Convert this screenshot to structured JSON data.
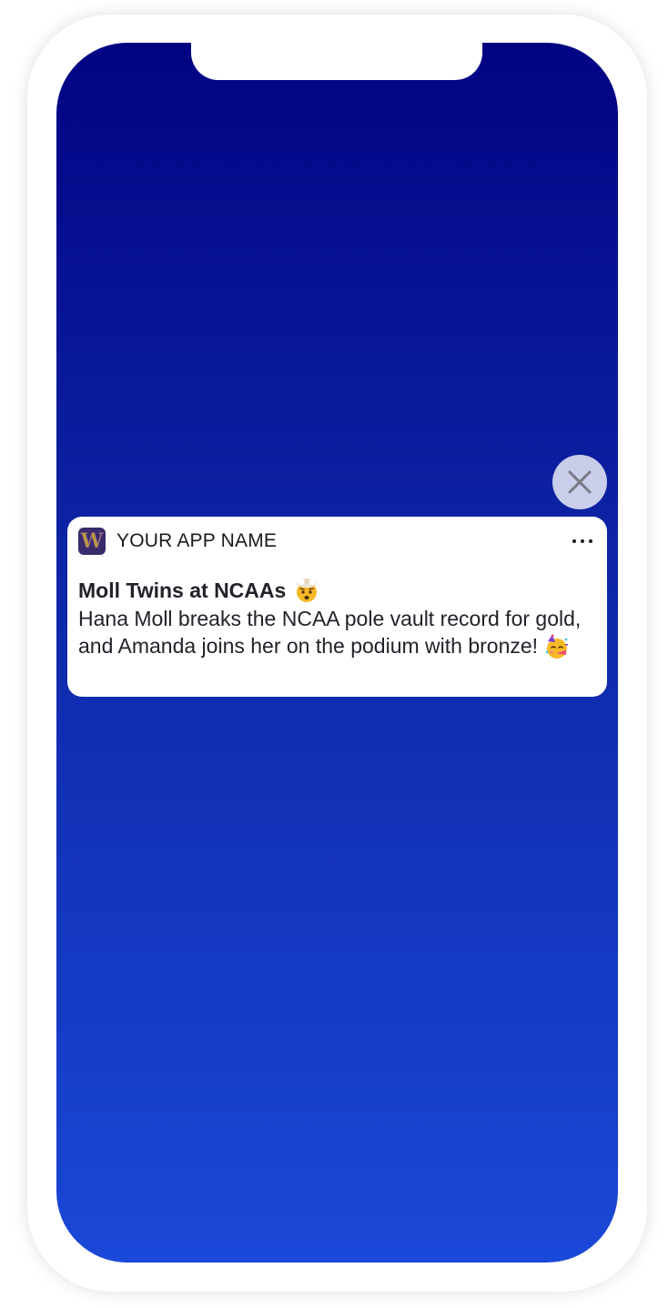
{
  "notification": {
    "app_name": "YOUR APP NAME",
    "app_icon_letter": "W",
    "title": "Moll Twins at NCAAs",
    "title_emoji": "exploding-head-emoji",
    "body": "Hana Moll breaks the NCAA pole vault record for gold, and Amanda joins her on the podium with bronze!",
    "body_emoji": "partying-face-emoji",
    "more_icon": "ellipsis-icon"
  },
  "close_icon": "close-icon",
  "colors": {
    "screen_top": "#020383",
    "screen_bottom": "#1a48d8",
    "card_background": "#ffffff",
    "text": "#22222a"
  }
}
